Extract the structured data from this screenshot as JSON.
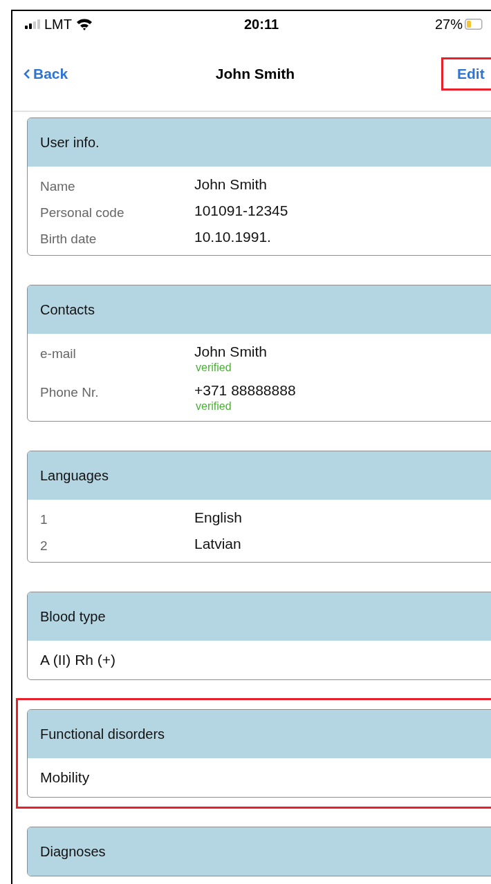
{
  "status_bar": {
    "carrier": "LMT",
    "time": "20:11",
    "battery": "27%"
  },
  "nav": {
    "back": "Back",
    "title": "John Smith",
    "edit": {
      "label": "Edit",
      "highlighted": true
    }
  },
  "sections": [
    {
      "title": "User info.",
      "kind": "fields",
      "highlighted": false,
      "rows": [
        {
          "label": "Name",
          "value": "John Smith"
        },
        {
          "label": "Personal code",
          "value": "101091-12345"
        },
        {
          "label": "Birth date",
          "value": "10.10.1991."
        }
      ]
    },
    {
      "title": "Contacts",
      "kind": "fields",
      "highlighted": false,
      "rows": [
        {
          "label": "e-mail",
          "value": "John Smith",
          "note": "verified"
        },
        {
          "label": "Phone Nr.",
          "value": "+371 88888888",
          "note": "verified"
        }
      ]
    },
    {
      "title": "Languages",
      "kind": "fields",
      "highlighted": false,
      "rows": [
        {
          "label": "1",
          "value": "English"
        },
        {
          "label": "2",
          "value": "Latvian"
        }
      ]
    },
    {
      "title": "Blood type",
      "kind": "text",
      "highlighted": false,
      "value": "A (II) Rh (+)"
    },
    {
      "title": "Functional disorders",
      "kind": "text",
      "highlighted": true,
      "value": "Mobility"
    },
    {
      "title": "Diagnoses",
      "kind": "text",
      "highlighted": false
    }
  ]
}
